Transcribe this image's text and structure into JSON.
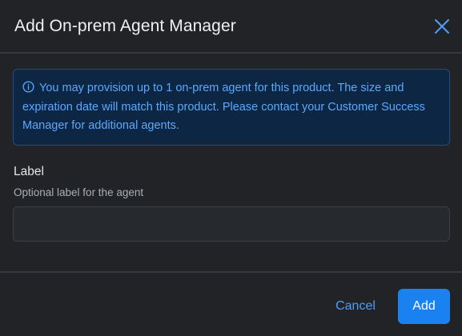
{
  "dialog": {
    "title": "Add On-prem Agent Manager",
    "close_icon": "close-icon"
  },
  "info": {
    "icon": "info-icon",
    "message": "You may provision up to 1 on-prem agent for this product. The size and expiration date will match this product. Please contact your Customer Success Manager for additional agents."
  },
  "form": {
    "label": "Label",
    "help": "Optional label for the agent",
    "value": "",
    "placeholder": ""
  },
  "footer": {
    "cancel_label": "Cancel",
    "add_label": "Add"
  },
  "colors": {
    "background": "#212326",
    "accent": "#1a82f0",
    "info_background": "#0c2644",
    "info_text": "#5aa9ff"
  }
}
